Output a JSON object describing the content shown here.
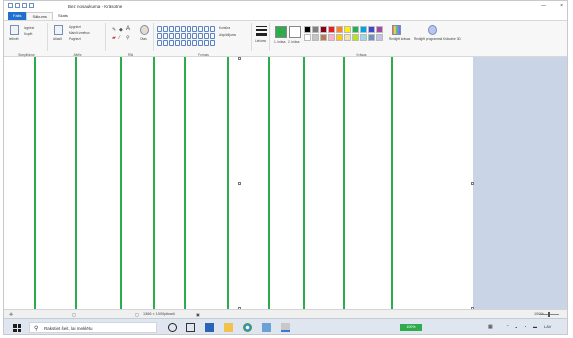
{
  "window": {
    "title": "Bez nosaukuma - Krāsotne",
    "controls": [
      "—",
      "×"
    ]
  },
  "tabs": [
    {
      "label": "Fails"
    },
    {
      "label": "Sākums"
    },
    {
      "label": "Skats"
    }
  ],
  "ribbon": {
    "groups": [
      {
        "label": "Starpliktuve"
      },
      {
        "label": "Attēls"
      },
      {
        "label": "Rīki"
      },
      {
        "label": "Formas"
      },
      {
        "label": "Krāsas"
      }
    ],
    "clipboard": {
      "paste": "Ielīmēt",
      "cut": "Izgriezt",
      "copy": "Kopēt"
    },
    "image": {
      "select": "Atlasīt",
      "crop": "Apgriezt",
      "resize": "Mainīt izmērus",
      "rotate": "Pagriezt"
    },
    "tools": {
      "brushes": "Otas"
    },
    "shapes": {
      "outline": "Kontūra",
      "fill": "Aizpildījums"
    },
    "size": {
      "label": "Lielums"
    },
    "colors": {
      "color1": "1. krāsa",
      "color2": "2. krāsa",
      "edit": "Rediģēt krāsas",
      "paint3d": "Rediģēt programmā Krāsotne 3D"
    },
    "palette_colors": [
      "#000000",
      "#7f7f7f",
      "#880015",
      "#ed1c24",
      "#ff7f27",
      "#fff200",
      "#22b14c",
      "#00a2e8",
      "#3f48cc",
      "#a349a4",
      "#ffffff",
      "#c3c3c3",
      "#b97a57",
      "#ffaec9",
      "#ffc90e",
      "#efe4b0",
      "#b5e61d",
      "#99d9ea",
      "#7092be",
      "#c8bfe7"
    ],
    "color1": "#2eab4a",
    "color2": "#ffffff"
  },
  "canvas": {
    "line_color": "#2eab4a",
    "line_count": 10
  },
  "status": {
    "dimensions": "1366 × 1000pikseļi",
    "zoom": "100%"
  },
  "taskbar": {
    "search_placeholder": "Rakstiet šeit, lai meklētu",
    "tray_lang": "LAV",
    "badge": "100%"
  }
}
